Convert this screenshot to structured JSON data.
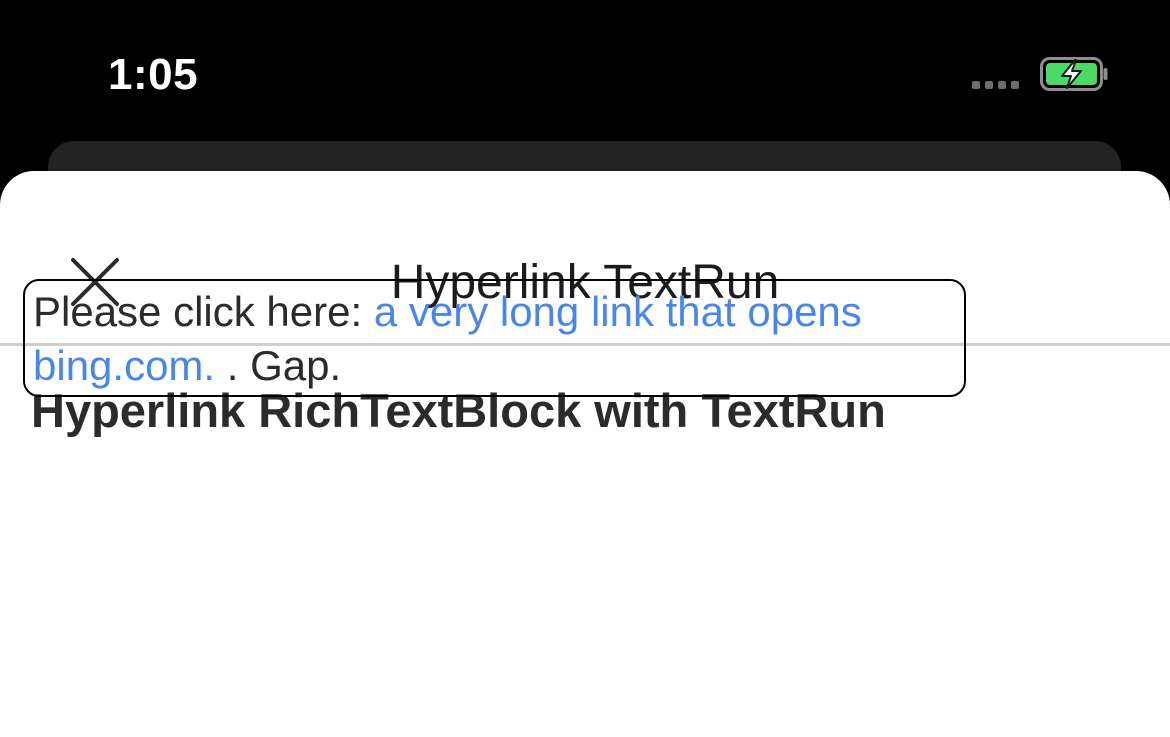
{
  "status_bar": {
    "time": "1:05",
    "battery_color": "#4cd964"
  },
  "sheet": {
    "title": "Hyperlink TextRun",
    "close_icon": "close-icon"
  },
  "content": {
    "heading": "Hyperlink RichTextBlock with TextRun",
    "rich_text": {
      "prefix": "Please click here: ",
      "link_text": "a very long link that opens bing.com.",
      "suffix": " . Gap."
    }
  },
  "colors": {
    "link": "#4a86e8",
    "background": "#000000",
    "sheet": "#ffffff"
  }
}
